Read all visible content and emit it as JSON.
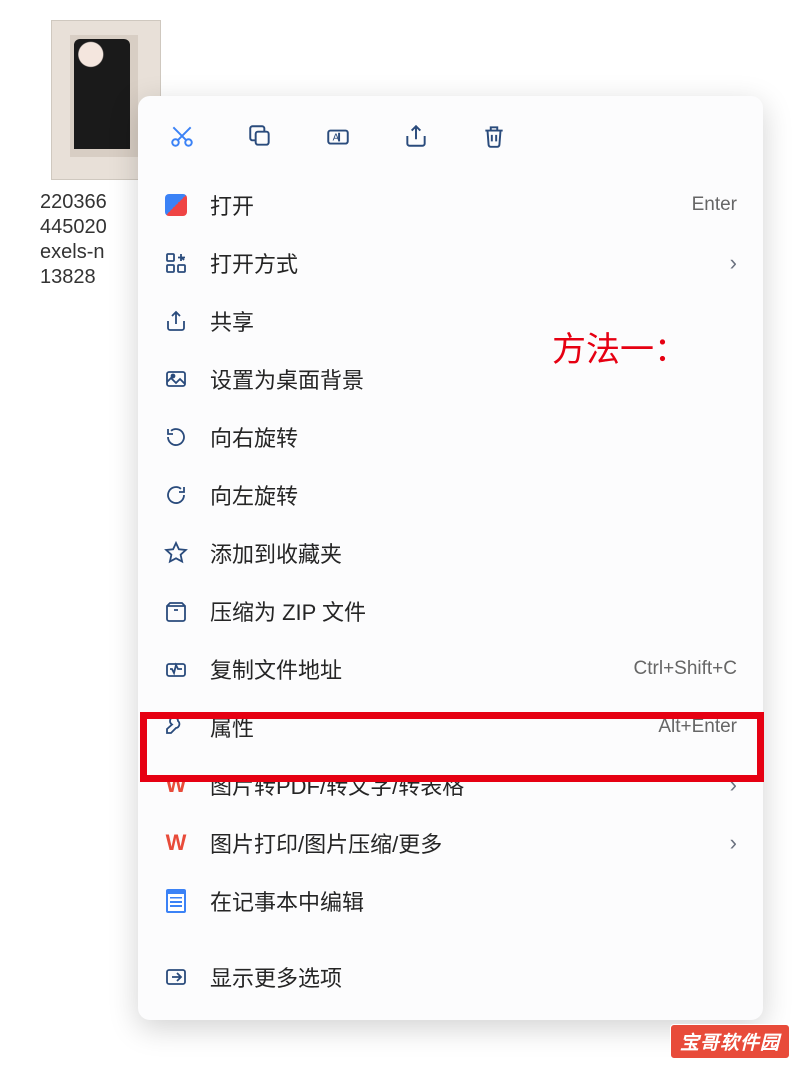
{
  "file": {
    "caption_lines": [
      "220366",
      "445020",
      "exels-n",
      "13828"
    ]
  },
  "annotation": "方法一：",
  "watermark": "宝哥软件园",
  "toolbar": {
    "cut": "cut-icon",
    "copy": "copy-icon",
    "rename": "rename-icon",
    "share": "share-icon",
    "delete": "delete-icon"
  },
  "menu": [
    {
      "icon": "open-icon",
      "label": "打开",
      "shortcut": "Enter",
      "has_chevron": false
    },
    {
      "icon": "open-with-icon",
      "label": "打开方式",
      "shortcut": "",
      "has_chevron": true
    },
    {
      "icon": "share-icon",
      "label": "共享",
      "shortcut": "",
      "has_chevron": false
    },
    {
      "icon": "wallpaper-icon",
      "label": "设置为桌面背景",
      "shortcut": "",
      "has_chevron": false
    },
    {
      "icon": "rotate-right-icon",
      "label": "向右旋转",
      "shortcut": "",
      "has_chevron": false
    },
    {
      "icon": "rotate-left-icon",
      "label": "向左旋转",
      "shortcut": "",
      "has_chevron": false
    },
    {
      "icon": "star-icon",
      "label": "添加到收藏夹",
      "shortcut": "",
      "has_chevron": false
    },
    {
      "icon": "zip-icon",
      "label": "压缩为 ZIP 文件",
      "shortcut": "",
      "has_chevron": false
    },
    {
      "icon": "copy-path-icon",
      "label": "复制文件地址",
      "shortcut": "Ctrl+Shift+C",
      "has_chevron": false
    },
    {
      "icon": "properties-icon",
      "label": "属性",
      "shortcut": "Alt+Enter",
      "has_chevron": false
    },
    {
      "icon": "wps-icon",
      "label": "图片转PDF/转文字/转表格",
      "shortcut": "",
      "has_chevron": true
    },
    {
      "icon": "wps-icon",
      "label": "图片打印/图片压缩/更多",
      "shortcut": "",
      "has_chevron": true
    },
    {
      "icon": "notepad-icon",
      "label": "在记事本中编辑",
      "shortcut": "",
      "has_chevron": false
    },
    {
      "icon": "more-options-icon",
      "label": "显示更多选项",
      "shortcut": "",
      "has_chevron": false
    }
  ]
}
